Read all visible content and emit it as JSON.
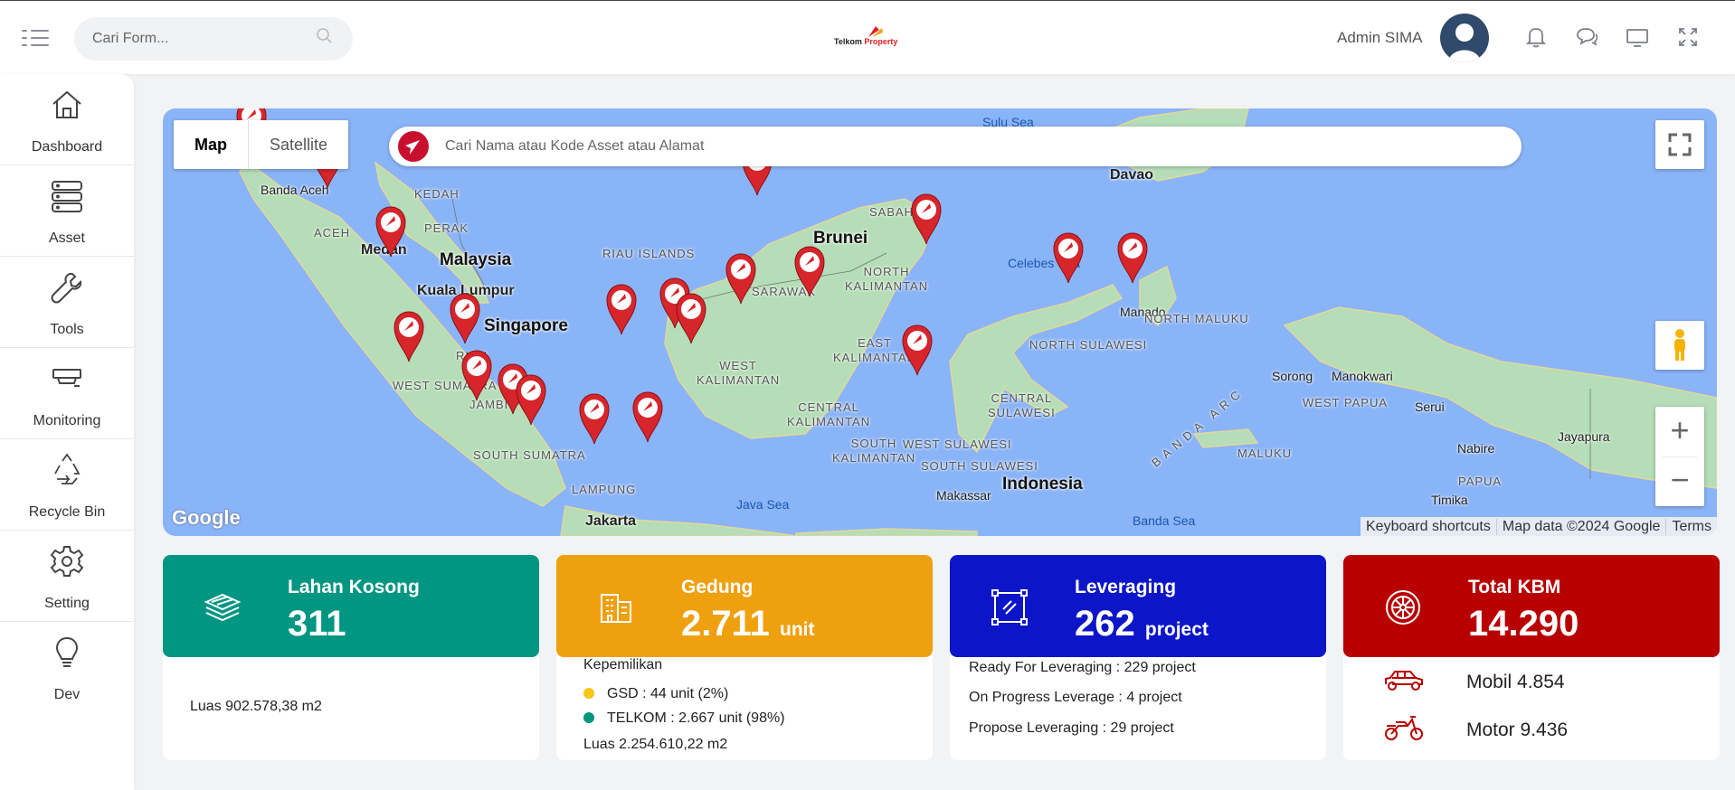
{
  "header": {
    "search_placeholder": "Cari Form...",
    "logo_text": "Telkom Property",
    "user_name": "Admin SIMA"
  },
  "sidebar": {
    "items": [
      {
        "label": "Dashboard",
        "icon": "home-icon"
      },
      {
        "label": "Asset",
        "icon": "server-icon"
      },
      {
        "label": "Tools",
        "icon": "wrench-icon"
      },
      {
        "label": "Monitoring",
        "icon": "cctv-icon"
      },
      {
        "label": "Recycle Bin",
        "icon": "recycle-icon"
      },
      {
        "label": "Setting",
        "icon": "gear-icon"
      },
      {
        "label": "Dev",
        "icon": "lightbulb-icon"
      }
    ]
  },
  "map": {
    "tabs": {
      "map": "Map",
      "satellite": "Satellite"
    },
    "search_placeholder": "Cari Nama atau Kode Asset atau Alamat",
    "attribution": {
      "shortcuts": "Keyboard shortcuts",
      "data": "Map data ©2024 Google",
      "terms": "Terms"
    },
    "brand": "Google",
    "labels": {
      "sulu_sea": "Sulu Sea",
      "davao": "Davao",
      "banda_aceh": "Banda Aceh",
      "kedah": "KEDAH",
      "perak": "PERAK",
      "aceh": "ACEH",
      "medan": "Medan",
      "malaysia": "Malaysia",
      "kuala_lumpur": "Kuala Lumpur",
      "riau_islands": "RIAU ISLANDS",
      "sabah": "SABAH",
      "brunei": "Brunei",
      "north_kalimantan": "NORTH\nKALIMANTAN",
      "sarawak": "SARAWAK",
      "celebes_sea": "Celebes Sea",
      "singapore": "Singapore",
      "riau": "RIAU",
      "manado": "Manado",
      "north_maluku": "NORTH MALUKU",
      "east_kalimantan": "EAST\nKALIMANTAN",
      "north_sulawesi": "NORTH SULAWESI",
      "west_kalimantan": "WEST\nKALIMANTAN",
      "central_kalimantan": "CENTRAL\nKALIMANTAN",
      "west_sumatra": "WEST SUMATRA",
      "jambi": "JAMBI",
      "central_sulawesi": "CENTRAL\nSULAWESI",
      "sorong": "Sorong",
      "manokwari": "Manokwari",
      "west_papua": "WEST PAPUA",
      "serui": "Serui",
      "south_sumatra": "SOUTH SUMATRA",
      "south_kalimantan": "SOUTH\nKALIMANTAN",
      "west_sulawesi": "WEST SULAWESI",
      "banda_arc": "BANDA ARC",
      "maluku": "MALUKU",
      "nabire": "Nabire",
      "jayapura": "Jayapura",
      "south_sulawesi": "SOUTH SULAWESI",
      "lampung": "LAMPUNG",
      "indonesia": "Indonesia",
      "papua": "PAPUA",
      "makassar": "Makassar",
      "java_sea": "Java Sea",
      "jakarta": "Jakarta",
      "timika": "Timika",
      "banda_sea": "Banda Sea"
    }
  },
  "cards": {
    "lahan": {
      "title": "Lahan Kosong",
      "value": "311",
      "unit": "",
      "luas": "Luas 902.578,38 m2",
      "color": "#009682",
      "icon": "layers-icon"
    },
    "gedung": {
      "title": "Gedung",
      "value": "2.711",
      "unit": "unit",
      "color": "#efa00f",
      "icon": "building-icon",
      "ownership_title": "Kepemilikan",
      "gsd": "GSD : 44 unit (2%)",
      "gsd_color": "#f5c518",
      "telkom": "TELKOM : 2.667 unit (98%)",
      "telkom_color": "#00967d",
      "luas": "Luas 2.254.610,22 m2"
    },
    "leveraging": {
      "title": "Leveraging",
      "value": "262",
      "unit": "project",
      "color": "#0c16c8",
      "icon": "frame-icon",
      "ready": "Ready For Leveraging : 229 project",
      "progress": "On Progress Leverage : 4 project",
      "propose": "Propose Leveraging : 29 project"
    },
    "kbm": {
      "title": "Total KBM",
      "value": "14.290",
      "unit": "",
      "color": "#b80000",
      "icon": "wheel-icon",
      "mobil": "Mobil 4.854",
      "motor": "Motor 9.436"
    }
  }
}
